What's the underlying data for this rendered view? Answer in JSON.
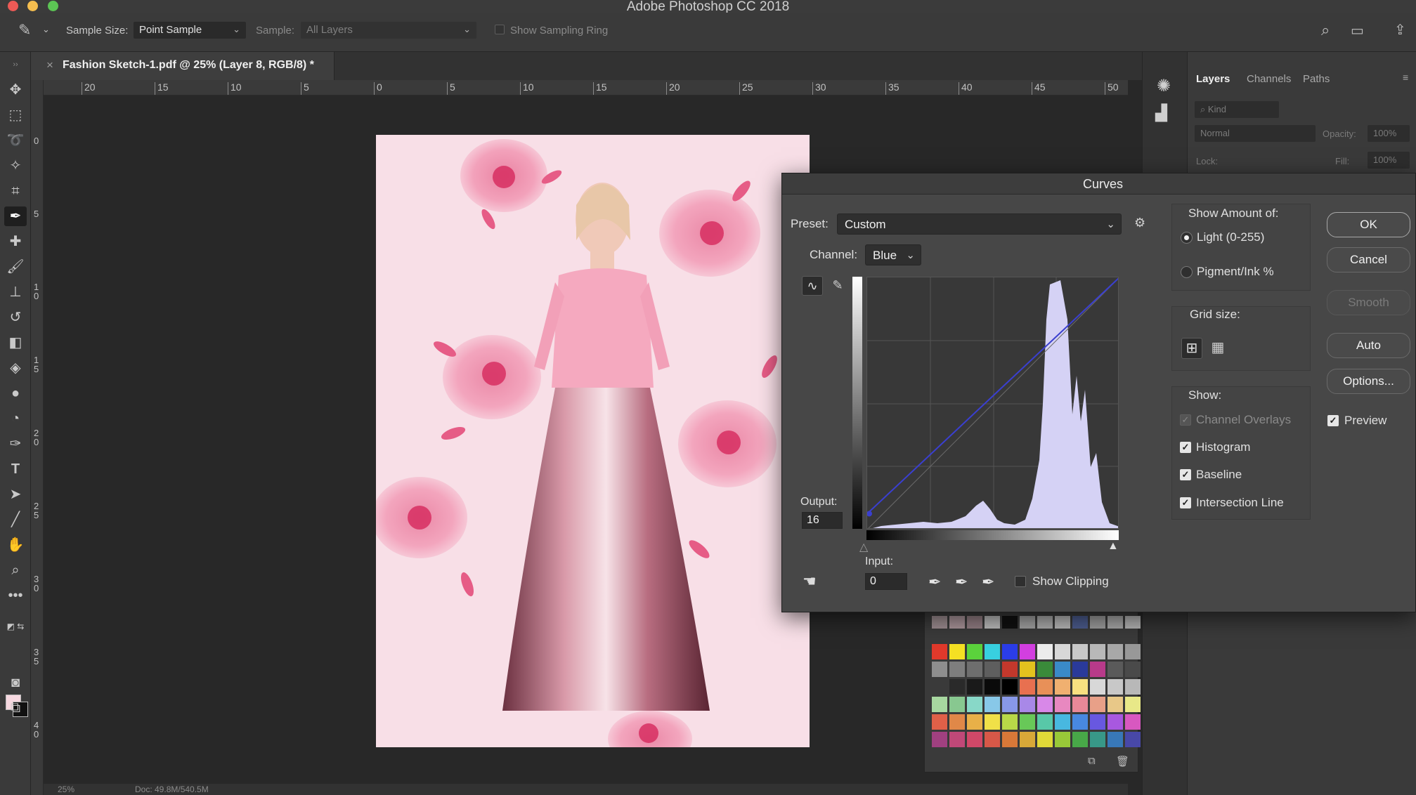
{
  "app": {
    "title": "Adobe Photoshop CC 2018"
  },
  "options_bar": {
    "sample_size_label": "Sample Size:",
    "sample_size_value": "Point Sample",
    "sample_label": "Sample:",
    "sample_value": "All Layers",
    "show_sampling_ring_label": "Show Sampling Ring"
  },
  "document": {
    "tab_title": "Fashion Sketch-1.pdf @ 25% (Layer 8, RGB/8) *"
  },
  "rulers": {
    "horizontal": [
      "20",
      "15",
      "10",
      "5",
      "0",
      "5",
      "10",
      "15",
      "20",
      "25",
      "30",
      "35",
      "40",
      "45",
      "50"
    ],
    "vertical": [
      "0",
      "5",
      "1\n0",
      "1\n5",
      "2\n0",
      "2\n5",
      "3\n0",
      "3\n5",
      "4\n0"
    ]
  },
  "status_bar": {
    "zoom": "25%",
    "doc": "Doc: 49.8M/540.5M"
  },
  "layers_panel": {
    "tabs": [
      "Layers",
      "Channels",
      "Paths"
    ],
    "active_tab": "Layers",
    "kind_label": "Kind",
    "blend_mode": "Normal",
    "opacity_label": "Opacity:",
    "opacity_value": "100%",
    "lock_label": "Lock:",
    "fill_label": "Fill:",
    "fill_value": "100%"
  },
  "curves": {
    "title": "Curves",
    "preset_label": "Preset:",
    "preset_value": "Custom",
    "channel_label": "Channel:",
    "channel_value": "Blue",
    "output_label": "Output:",
    "output_value": "16",
    "input_label": "Input:",
    "input_value": "0",
    "show_clipping_label": "Show Clipping",
    "show_clipping_checked": false,
    "show_amount_label": "Show Amount of:",
    "light_label": "Light  (0-255)",
    "pigment_label": "Pigment/Ink %",
    "amount_selected": "light",
    "grid_size_label": "Grid size:",
    "show_label": "Show:",
    "channel_overlays_label": "Channel Overlays",
    "histogram_label": "Histogram",
    "baseline_label": "Baseline",
    "intersection_line_label": "Intersection Line",
    "histogram_checked": true,
    "baseline_checked": true,
    "intersection_checked": true,
    "buttons": {
      "ok": "OK",
      "cancel": "Cancel",
      "smooth": "Smooth",
      "auto": "Auto",
      "options": "Options..."
    },
    "preview_label": "Preview",
    "preview_checked": true,
    "curve_points": [
      [
        0,
        16
      ],
      [
        255,
        255
      ]
    ],
    "histogram_color": "#d5d2f5"
  },
  "colors": {
    "accent_curve": "#3a3fd0",
    "artwork_bg": "#f8dfe7"
  }
}
